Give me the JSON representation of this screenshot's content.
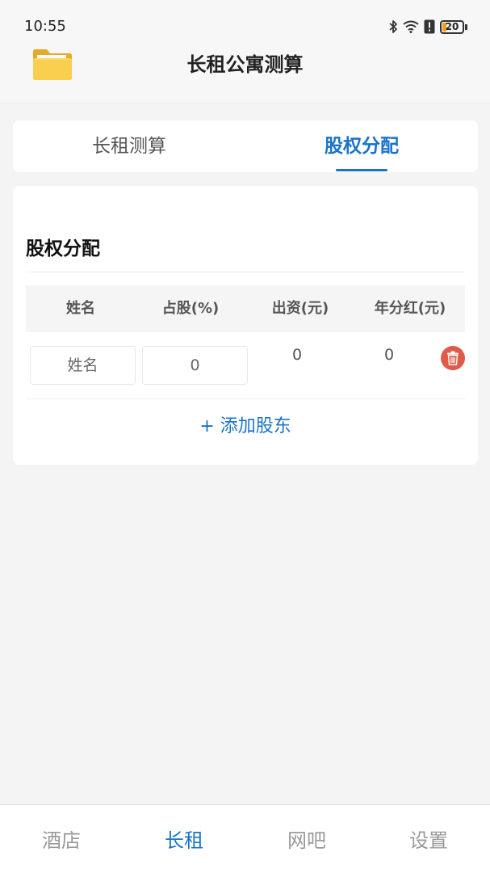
{
  "status_bar": {
    "time": "10:55",
    "battery": "20"
  },
  "header": {
    "title": "长租公寓测算",
    "icon": "folder-icon"
  },
  "tabs": [
    {
      "label": "长租测算",
      "active": false
    },
    {
      "label": "股权分配",
      "active": true
    }
  ],
  "section": {
    "title": "股权分配"
  },
  "table": {
    "columns": [
      "姓名",
      "占股(%)",
      "出资(元)",
      "年分红(元)"
    ],
    "rows": [
      {
        "name_placeholder": "姓名",
        "share": "0",
        "capital": "0",
        "dividend": "0"
      }
    ]
  },
  "add_button": {
    "label": "+ 添加股东"
  },
  "bottom_nav": [
    {
      "label": "酒店",
      "active": false
    },
    {
      "label": "长租",
      "active": true
    },
    {
      "label": "网吧",
      "active": false
    },
    {
      "label": "设置",
      "active": false
    }
  ],
  "colors": {
    "accent": "#1a73c8",
    "danger": "#e05a4a",
    "background": "#f4f4f4"
  }
}
